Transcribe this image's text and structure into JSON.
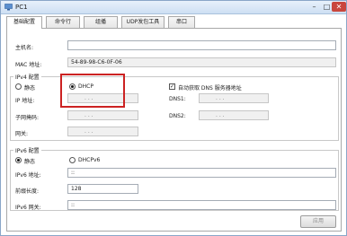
{
  "window": {
    "title": "PC1",
    "min": "–",
    "max": "□",
    "close": "✕"
  },
  "tabs": [
    {
      "label": "基础配置",
      "active": true
    },
    {
      "label": "命令行"
    },
    {
      "label": "组播"
    },
    {
      "label": "UDP发包工具"
    },
    {
      "label": "串口"
    }
  ],
  "basic": {
    "hostname_label": "主机名:",
    "hostname_value": "",
    "mac_label": "MAC 地址:",
    "mac_value": "54-89-98-C6-0F-06"
  },
  "ipv4": {
    "group_title": "IPv4 配置",
    "static_label": "静态",
    "dhcp_label": "DHCP",
    "mode": "DHCP",
    "ip_label": "IP 地址:",
    "mask_label": "子网掩码:",
    "gateway_label": "网关:",
    "auto_dns_label": "自动获取 DNS 服务器地址",
    "auto_dns_checked": "✓",
    "dns1_label": "DNS1:",
    "dns2_label": "DNS2:",
    "ip_dots": ".    .    ."
  },
  "ipv6": {
    "group_title": "IPv6 配置",
    "static_label": "静态",
    "dhcp_label": "DHCPv6",
    "mode": "静态",
    "address_label": "IPv6 地址:",
    "address_value": "::",
    "prefix_label": "前缀长度:",
    "prefix_value": "128",
    "gateway_label": "IPv6 网关:",
    "gateway_value": "::"
  },
  "apply_label": "应用",
  "colors": {
    "highlight": "#cc2222",
    "title_bg": "#cddff3"
  }
}
